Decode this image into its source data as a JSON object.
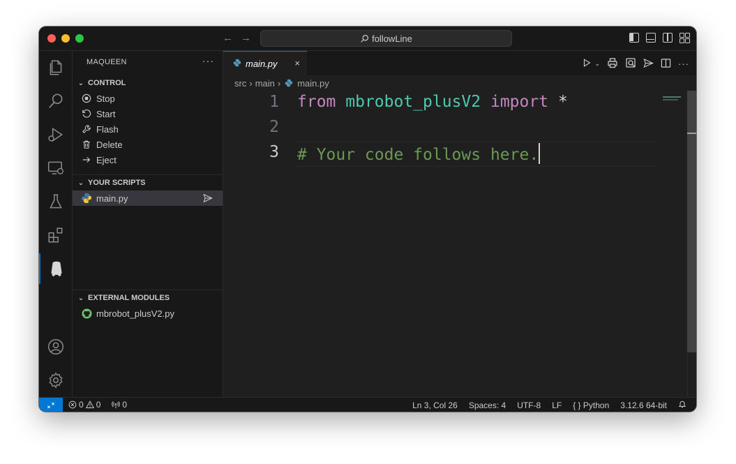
{
  "titlebar": {
    "search_text": "followLine",
    "back_arrow": "←",
    "forward_arrow": "→"
  },
  "activitybar": {
    "icons": [
      "files-icon",
      "search-icon",
      "run-debug-icon",
      "remote-explorer-icon",
      "testing-icon",
      "extensions-icon",
      "maqueen-robot-icon",
      "account-icon",
      "settings-gear-icon"
    ]
  },
  "sidebar": {
    "title": "MAQUEEN",
    "more": "···",
    "control": {
      "header": "CONTROL",
      "items": [
        {
          "label": "Stop",
          "icon": "stop-circle-icon"
        },
        {
          "label": "Start",
          "icon": "refresh-icon"
        },
        {
          "label": "Flash",
          "icon": "wrench-icon"
        },
        {
          "label": "Delete",
          "icon": "trash-icon"
        },
        {
          "label": "Eject",
          "icon": "eject-arrow-icon"
        }
      ]
    },
    "scripts": {
      "header": "YOUR SCRIPTS",
      "items": [
        {
          "label": "main.py",
          "icon": "python-icon"
        }
      ]
    },
    "modules": {
      "header": "EXTERNAL MODULES",
      "items": [
        {
          "label": "mbrobot_plusV2.py",
          "icon": "github-icon"
        }
      ]
    }
  },
  "editor": {
    "tab_label": "main.py",
    "tab_close": "×",
    "breadcrumb": [
      "src",
      "main",
      "main.py"
    ],
    "line_numbers": [
      "1",
      "2",
      "3"
    ],
    "line1": {
      "kw1": "from",
      "mod": "mbrobot_plusV2",
      "kw2": "import",
      "op": "*"
    },
    "line3_comment": "# Your code follows here."
  },
  "statusbar": {
    "errors": "0",
    "warnings": "0",
    "ports": "0",
    "cursor": "Ln 3, Col 26",
    "spaces": "Spaces: 4",
    "encoding": "UTF-8",
    "eol": "LF",
    "language": "Python",
    "language_prefix": "{ }",
    "interpreter": "3.12.6 64-bit"
  },
  "colors": {
    "accent": "#0078d4",
    "keyword": "#c586c0",
    "module": "#4ec9b0",
    "comment": "#6a9955"
  }
}
